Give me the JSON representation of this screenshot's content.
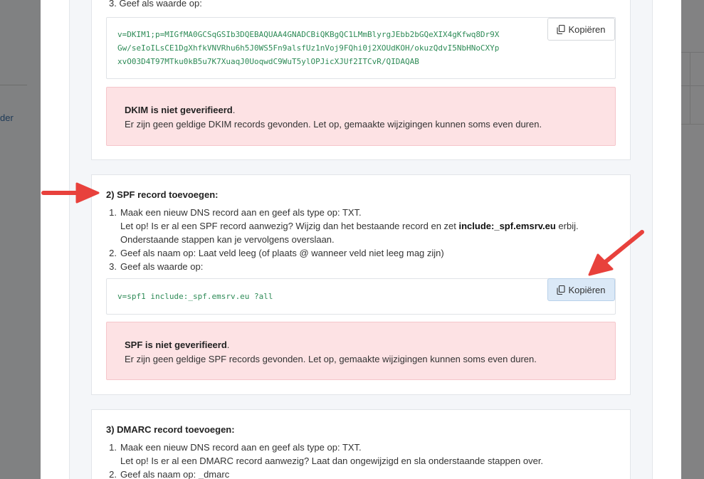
{
  "background": {
    "link_fragment": "der"
  },
  "dkim": {
    "step3_label": "3. Geef als waarde op:",
    "value_lines": [
      "v=DKIM1;p=MIGfMA0GCSqGSIb3DQEBAQUAA4GNADCBiQKBgQC1LMmBlyrgJEbb2bGQeXIX4gKfwq8Dr9X",
      "Gw/seIoILsCE1DgXhfkVNVRhu6h5J0WS5Fn9alsfUz1nVoj9FQhi0j2XOUdKOH/okuzQdvI5NbHNoCXYp",
      "xvO03D4T97MTku0kB5u7K7XuaqJ0UoqwdC9WuT5ylOPJicXJUf2ITCvR/QIDAQAB"
    ],
    "copy_label": "Kopiëren",
    "alert_title": "DKIM is niet geverifieerd",
    "alert_title_suffix": ".",
    "alert_text": "Er zijn geen geldige DKIM records gevonden. Let op, gemaakte wijzigingen kunnen soms even duren."
  },
  "spf": {
    "heading": "2) SPF record toevoegen:",
    "step1_num": "1.",
    "step1_text": "Maak een nieuw DNS record aan en geef als type op: TXT.",
    "step1_note_pre": "Let op! Is er al een SPF record aanwezig? Wijzig dan het bestaande record en zet ",
    "step1_note_bold": "include:_spf.emsrv.eu",
    "step1_note_post": " erbij.",
    "step1_note_line2": "Onderstaande stappen kan je vervolgens overslaan.",
    "step2_num": "2.",
    "step2_text": "Geef als naam op: Laat veld leeg (of plaats @ wanneer veld niet leeg mag zijn)",
    "step3_num": "3.",
    "step3_text": "Geef als waarde op:",
    "value": "v=spf1 include:_spf.emsrv.eu ?all",
    "copy_label": "Kopiëren",
    "alert_title": "SPF is niet geverifieerd",
    "alert_title_suffix": ".",
    "alert_text": "Er zijn geen geldige SPF records gevonden. Let op, gemaakte wijzigingen kunnen soms even duren."
  },
  "dmarc": {
    "heading": "3) DMARC record toevoegen:",
    "step1_num": "1.",
    "step1_text": "Maak een nieuw DNS record aan en geef als type op: TXT.",
    "step1_note": "Let op! Is er al een DMARC record aanwezig? Laat dan ongewijzigd en sla onderstaande stappen over.",
    "step2_num": "2.",
    "step2_text": "Geef als naam op: _dmarc"
  },
  "colors": {
    "arrow": "#e8413c",
    "code": "#2e8b57",
    "alert_bg": "#fde2e4",
    "copy_hover_bg": "#dbe9f7"
  }
}
